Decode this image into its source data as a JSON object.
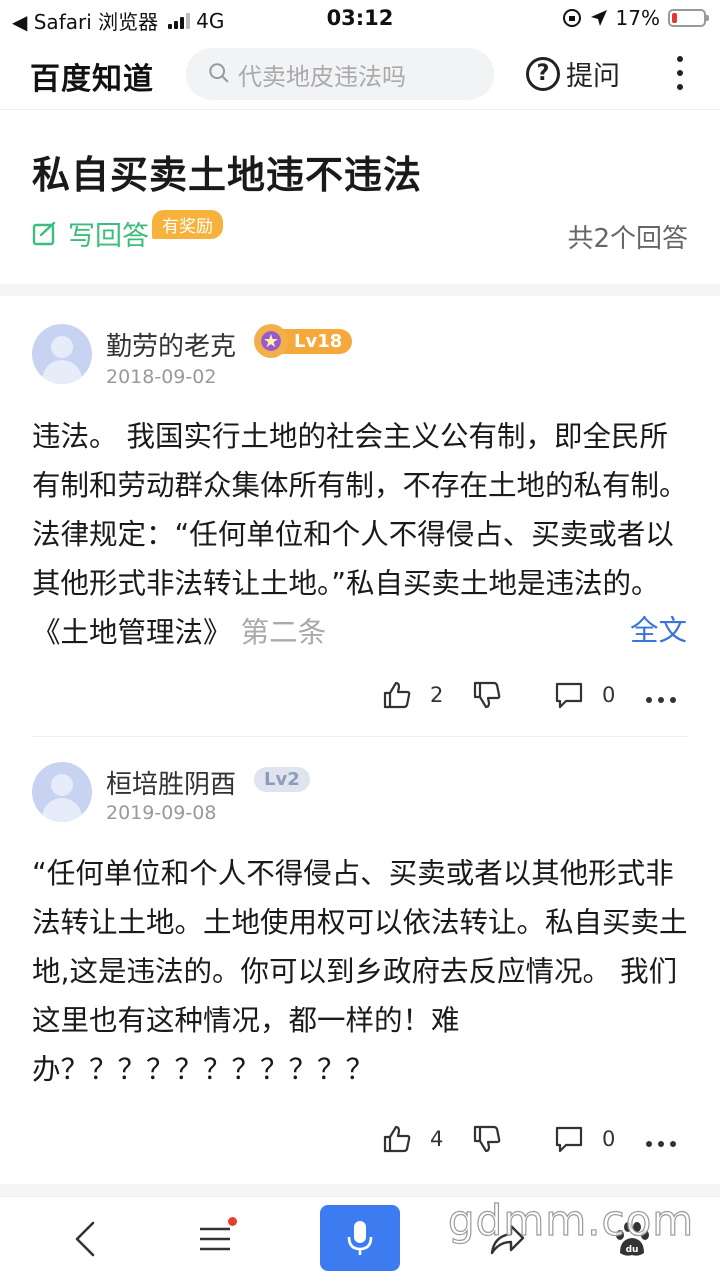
{
  "status_bar": {
    "back_label": "◀ Safari 浏览器",
    "network": "4G",
    "time": "03:12",
    "battery": "17%",
    "battery_level": 0.17
  },
  "header": {
    "logo": "百度知道",
    "search_placeholder": "代卖地皮违法吗",
    "ask_label": "提问"
  },
  "question": {
    "title": "私自买卖土地违不违法",
    "write_answer_label": "写回答",
    "reward_badge": "有奖励",
    "answer_count": "共2个回答"
  },
  "answers": [
    {
      "username": "勤劳的老克",
      "level": "Lv18",
      "date": "2018-09-02",
      "text": "违法。 我国实行土地的社会主义公有制，即全民所有制和劳动群众集体所有制，不存在土地的私有制。 法律规定：“任何单位和个人不得侵占、买卖或者以其他形式非法转让土地。”私自买卖土地是违法的。 《土地管理法》 ",
      "text_fade": "第二条",
      "full_text_label": "全文",
      "likes": "2",
      "comments": "0"
    },
    {
      "username": "桓培胜阴酉",
      "level": "Lv2",
      "date": "2019-09-08",
      "text": "“任何单位和个人不得侵占、买卖或者以其他形式非法转让土地。土地使用权可以依法转让。私自买卖土地,这是违法的。你可以到乡政府去反应情况。 我们这里也有这种情况，都一样的！难办？？？？？？？？？？？",
      "likes": "4",
      "comments": "0"
    }
  ],
  "watermark": "gdmm.com",
  "colors": {
    "accent_green": "#3dbd7d",
    "link_blue": "#3974d6",
    "mic_blue": "#3c7cf0",
    "reward_orange": "#f6b23c"
  }
}
